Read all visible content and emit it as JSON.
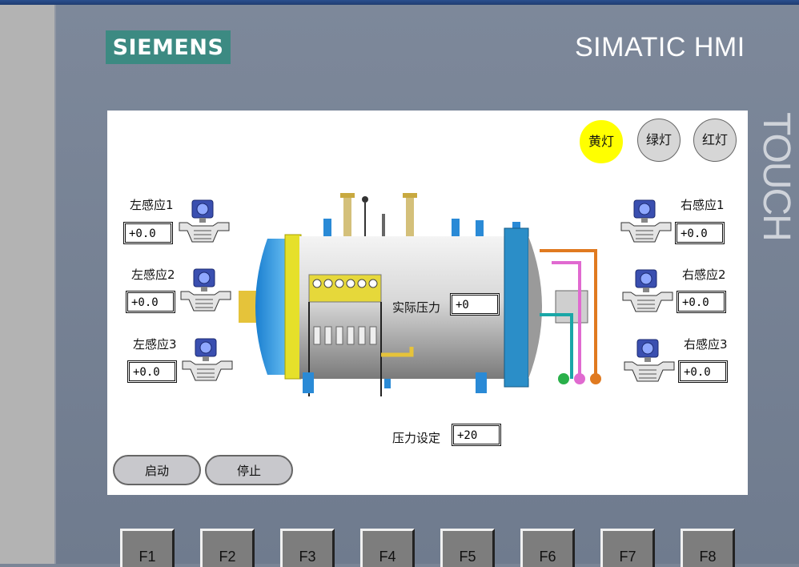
{
  "brand": {
    "logo": "SIEMENS",
    "title": "SIMATIC HMI",
    "touch": "TOUCH"
  },
  "lamps": [
    {
      "label": "黄灯",
      "state": "on",
      "color": "#ffff00"
    },
    {
      "label": "绿灯",
      "state": "off",
      "color": "#d6d6d6"
    },
    {
      "label": "红灯",
      "state": "off",
      "color": "#d6d6d6"
    }
  ],
  "left_sensors": [
    {
      "label": "左感应1",
      "value": "+0.0"
    },
    {
      "label": "左感应2",
      "value": "+0.0"
    },
    {
      "label": "左感应3",
      "value": "+0.0"
    }
  ],
  "right_sensors": [
    {
      "label": "右感应1",
      "value": "+0.0"
    },
    {
      "label": "右感应2",
      "value": "+0.0"
    },
    {
      "label": "右感应3",
      "value": "+0.0"
    }
  ],
  "actual_pressure": {
    "label": "实际压力",
    "value": "+0"
  },
  "pressure_setpoint": {
    "label": "压力设定",
    "value": "+20"
  },
  "buttons": {
    "start": "启动",
    "stop": "停止"
  },
  "function_keys": [
    "F1",
    "F2",
    "F3",
    "F4",
    "F5",
    "F6",
    "F7",
    "F8"
  ]
}
